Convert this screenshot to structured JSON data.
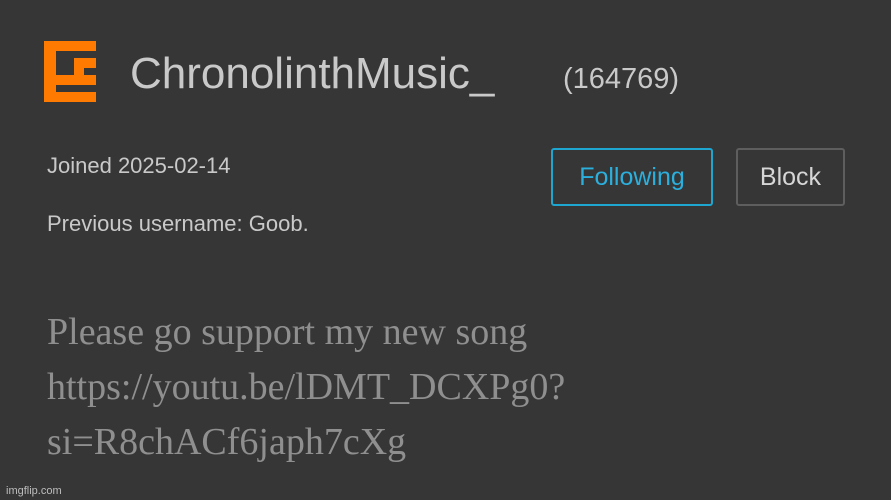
{
  "profile": {
    "username": "ChronolinthMusic_",
    "user_id": "(164769)",
    "joined": "Joined 2025-02-14",
    "previous_username": "Previous username: Goob.",
    "logo_icon": "orange-bracket-logo-icon",
    "logo_color": "#ff7a00"
  },
  "actions": {
    "following_label": "Following",
    "block_label": "Block",
    "following_color": "#2bb0de"
  },
  "bio": {
    "lines": [
      "Please go support my new song",
      "https://youtu.be/lDMT_DCXPg0?",
      "si=R8chACf6japh7cXg"
    ]
  },
  "watermark": "imgflip.com"
}
